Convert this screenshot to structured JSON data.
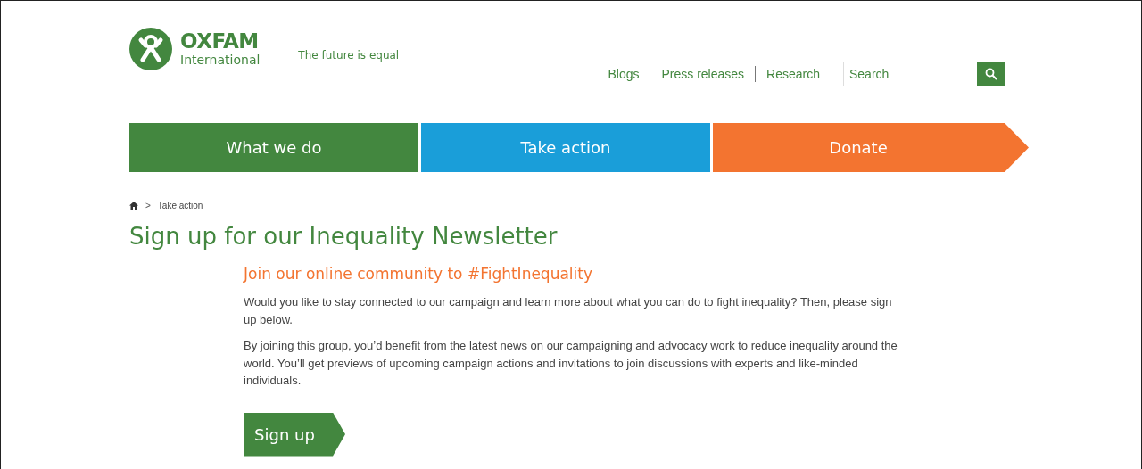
{
  "logo": {
    "name": "OXFAM",
    "subtitle": "International"
  },
  "tagline": "The future is equal",
  "top_links": [
    "Blogs",
    "Press releases",
    "Research"
  ],
  "search": {
    "placeholder": "Search"
  },
  "nav": [
    {
      "label": "What we do",
      "color": "#43873f",
      "kind": "plain"
    },
    {
      "label": "Take action",
      "color": "#1a9ed9",
      "kind": "plain"
    },
    {
      "label": "Donate",
      "color": "#f37430",
      "kind": "arrow"
    }
  ],
  "breadcrumb": [
    {
      "separator": ">",
      "label": "Take action"
    }
  ],
  "title": "Sign up for our Inequality Newsletter",
  "subtitle": "Join our online community to #FightInequality",
  "paragraphs": [
    "Would you like to stay connected to our campaign and learn more about what you can do to fight inequality? Then, please sign up below.",
    "By joining this group, you’d benefit from the latest news on our campaigning and advocacy work to reduce inequality around the world.  You’ll get previews of upcoming campaign actions and invitations to join discussions with experts and like-minded individuals."
  ],
  "signup_button": "Sign up"
}
